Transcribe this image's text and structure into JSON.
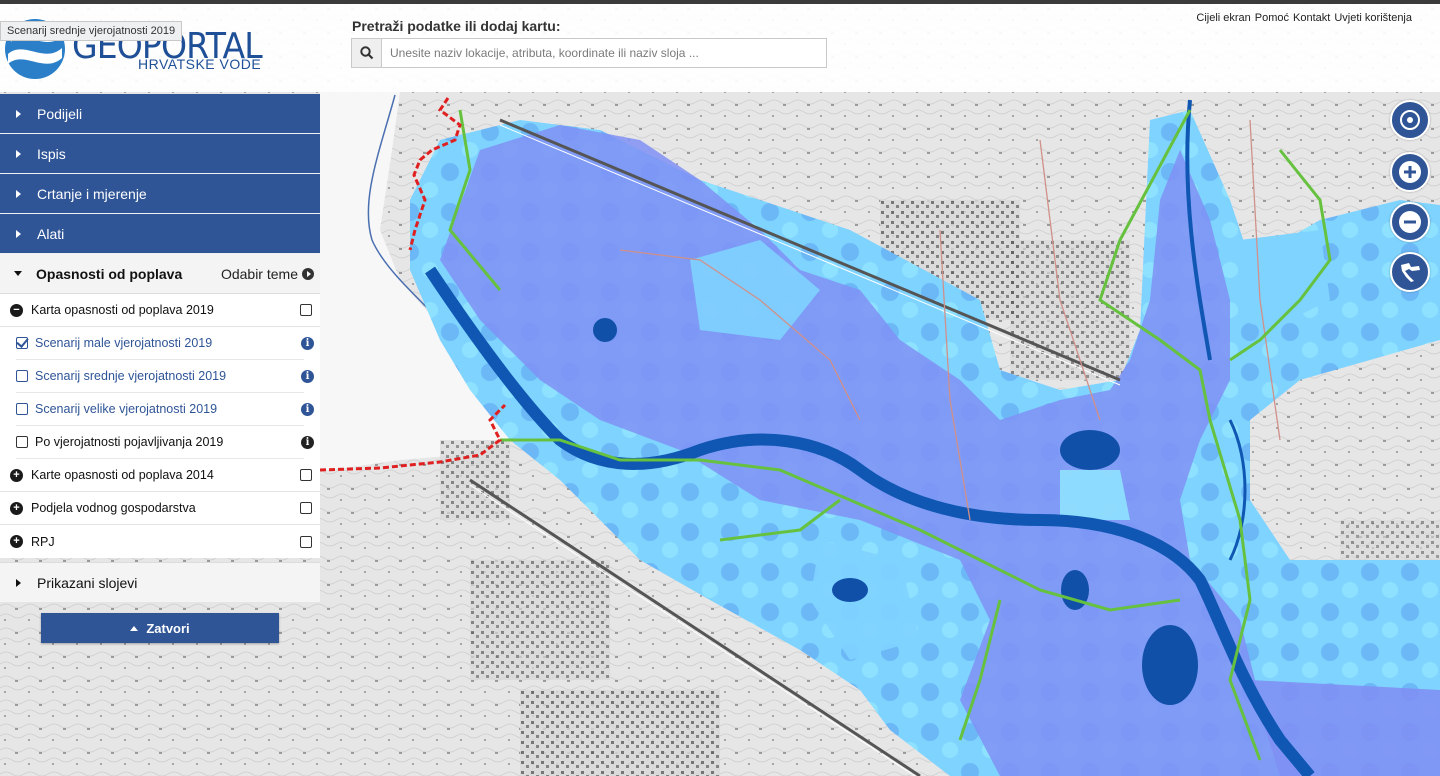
{
  "header": {
    "logo_title": "GEOPORTAL",
    "logo_subtitle": "HRVATSKE VODE",
    "tooltip": "Scenarij srednje vjerojatnosti 2019",
    "search_label": "Pretraži podatke ili dodaj kartu:",
    "search_placeholder": "Unesite naziv lokacije, atributa, koordinate ili naziv sloja ...",
    "links": [
      "Cijeli ekran",
      "Pomoć",
      "Kontakt",
      "Uvjeti korištenja"
    ]
  },
  "sidebar": {
    "sections": [
      "Podijeli",
      "Ispis",
      "Crtanje i mjerenje",
      "Alati"
    ],
    "open_section": {
      "title": "Opasnosti od poplava",
      "theme_link": "Odabir teme"
    },
    "tree": {
      "group_2019": {
        "label": "Karta opasnosti od poplava 2019",
        "expanded": true,
        "checked": false
      },
      "scenarios": [
        {
          "label": "Scenarij male vjerojatnosti 2019",
          "checked": true
        },
        {
          "label": "Scenarij srednje vjerojatnosti 2019",
          "checked": false
        },
        {
          "label": "Scenarij velike vjerojatnosti 2019",
          "checked": false
        },
        {
          "label": "Po vjerojatnosti pojavljivanja 2019",
          "checked": false
        }
      ],
      "groups": [
        {
          "label": "Karte opasnosti od poplava 2014"
        },
        {
          "label": "Podjela vodnog gospodarstva"
        },
        {
          "label": "RPJ"
        }
      ]
    },
    "prikazani": "Prikazani slojevi",
    "close_button": "Zatvori"
  },
  "map_controls": [
    "locate-icon",
    "zoom-in-icon",
    "zoom-out-icon",
    "croatia-extent-icon"
  ],
  "colors": {
    "brand": "#2f5597",
    "flood_light": "#7fdcff",
    "flood_mid": "#5aa8f0",
    "flood_dark": "#7f8ff5",
    "river": "#0d4fa8",
    "boundary_red": "#e02020",
    "boundary_green": "#5fbf3a"
  }
}
